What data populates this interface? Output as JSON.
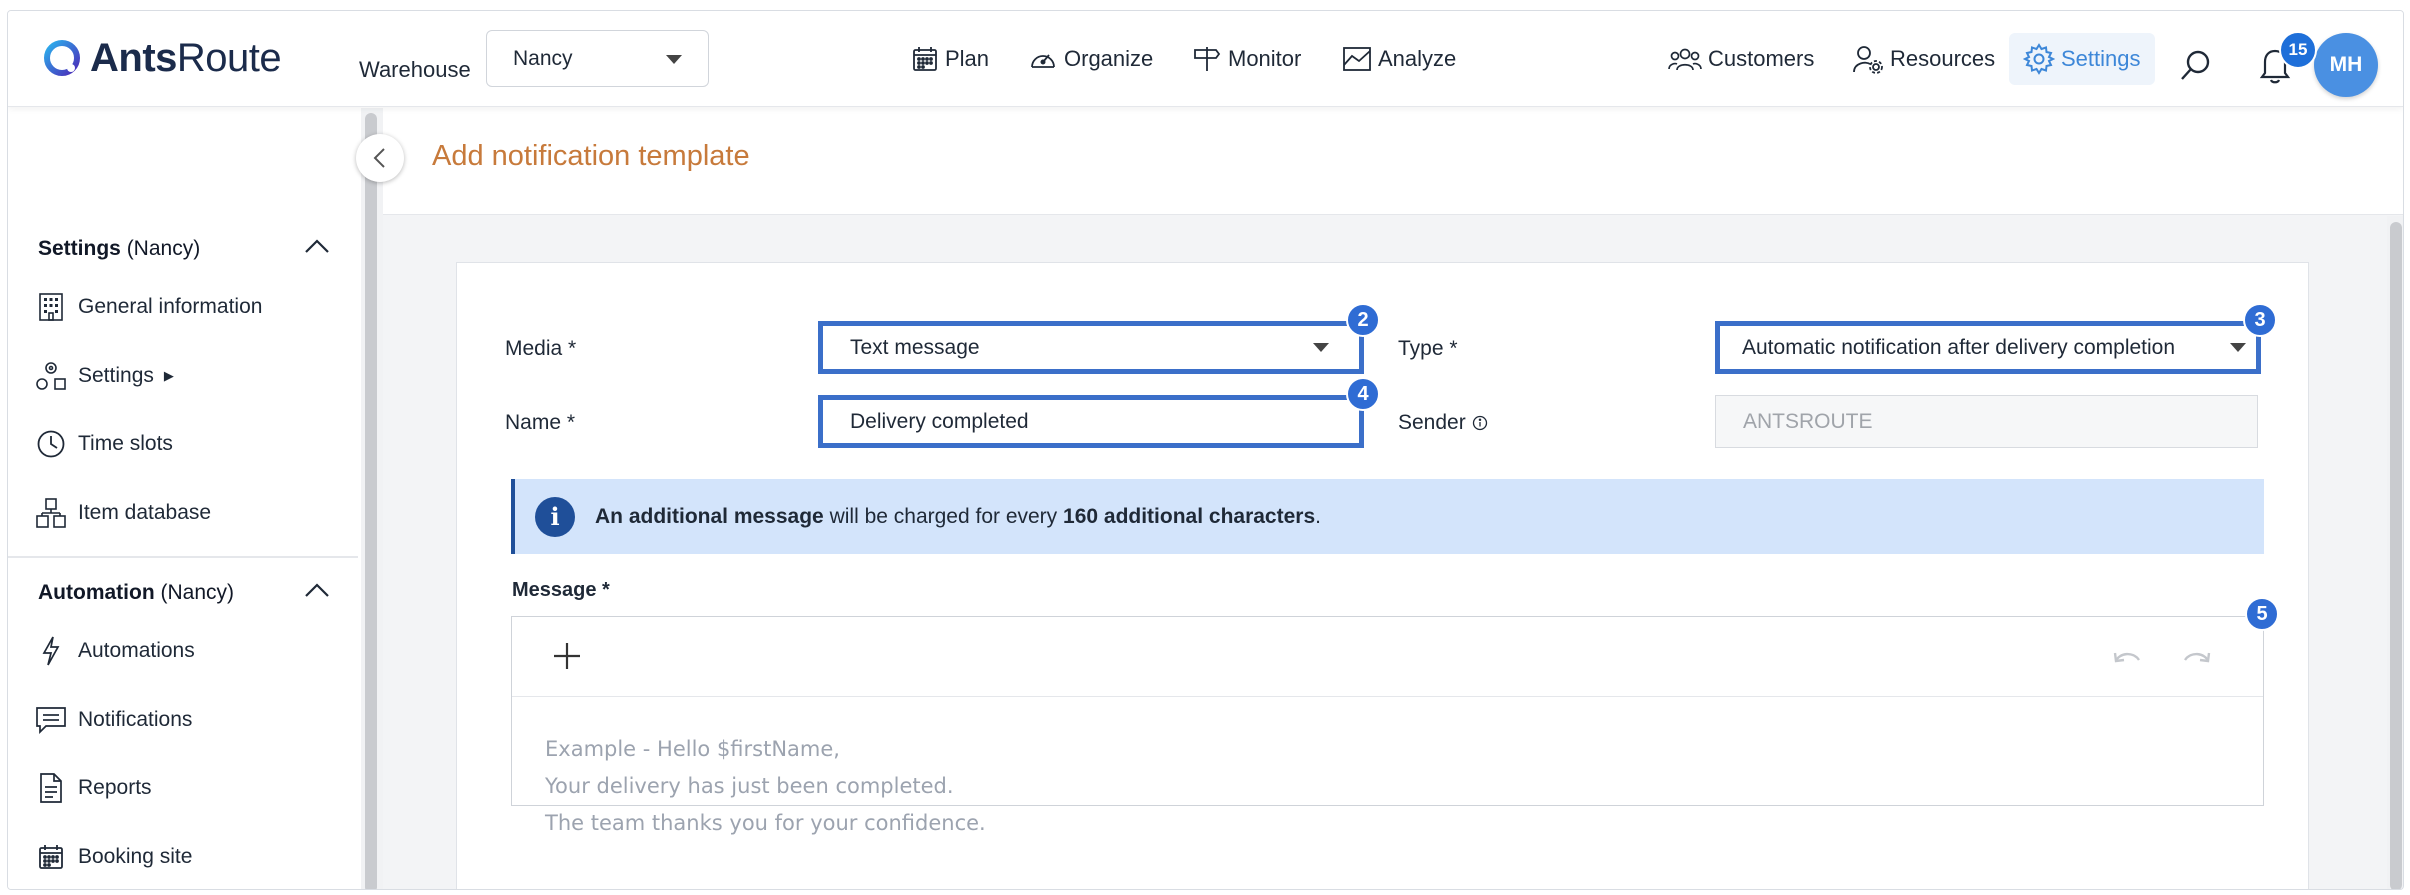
{
  "brand": {
    "name_bold": "Ants",
    "name_light": "Route"
  },
  "header": {
    "warehouse_label": "Warehouse",
    "warehouse_value": "Nancy",
    "nav": [
      {
        "label": "Plan",
        "icon": "calendar-icon"
      },
      {
        "label": "Organize",
        "icon": "gauge-icon"
      },
      {
        "label": "Monitor",
        "icon": "signpost-icon"
      },
      {
        "label": "Analyze",
        "icon": "chart-icon"
      }
    ],
    "right_nav": [
      {
        "label": "Customers",
        "icon": "users-icon"
      },
      {
        "label": "Resources",
        "icon": "user-gear-icon"
      },
      {
        "label": "Settings",
        "icon": "gear-icon",
        "active": true
      }
    ],
    "notification_count": "15",
    "avatar_initials": "MH",
    "accent_color": "#3d87d8"
  },
  "sidebar": {
    "settings_section": {
      "title": "Settings",
      "context": "(Nancy)"
    },
    "settings_items": [
      {
        "label": "General information",
        "icon": "building-icon"
      },
      {
        "label": "Settings",
        "icon": "shapes-icon",
        "has_submenu": true
      },
      {
        "label": "Time slots",
        "icon": "clock-icon"
      },
      {
        "label": "Item database",
        "icon": "boxes-icon"
      }
    ],
    "automation_section": {
      "title": "Automation",
      "context": "(Nancy)"
    },
    "automation_items": [
      {
        "label": "Automations",
        "icon": "bolt-icon"
      },
      {
        "label": "Notifications",
        "icon": "message-icon"
      },
      {
        "label": "Reports",
        "icon": "document-icon"
      },
      {
        "label": "Booking site",
        "icon": "calendar-icon"
      }
    ]
  },
  "page": {
    "title": "Add notification template",
    "title_color": "#c77a3b"
  },
  "form": {
    "media_label": "Media *",
    "media_value": "Text message",
    "type_label": "Type *",
    "type_value": "Automatic notification after delivery completion",
    "name_label": "Name *",
    "name_value": "Delivery completed",
    "sender_label": "Sender",
    "sender_value": "ANTSROUTE",
    "info": {
      "part1": "An additional message",
      "part2": " will be charged for every ",
      "part3": "160 additional characters",
      "part4": "."
    },
    "message_label": "Message *",
    "message_placeholder_lines": [
      "Example - Hello $firstName,",
      "Your delivery has just been completed.",
      "The team thanks you for your confidence."
    ]
  },
  "annotations": [
    "2",
    "3",
    "4",
    "5"
  ],
  "highlight_color": "#3b6fc9"
}
